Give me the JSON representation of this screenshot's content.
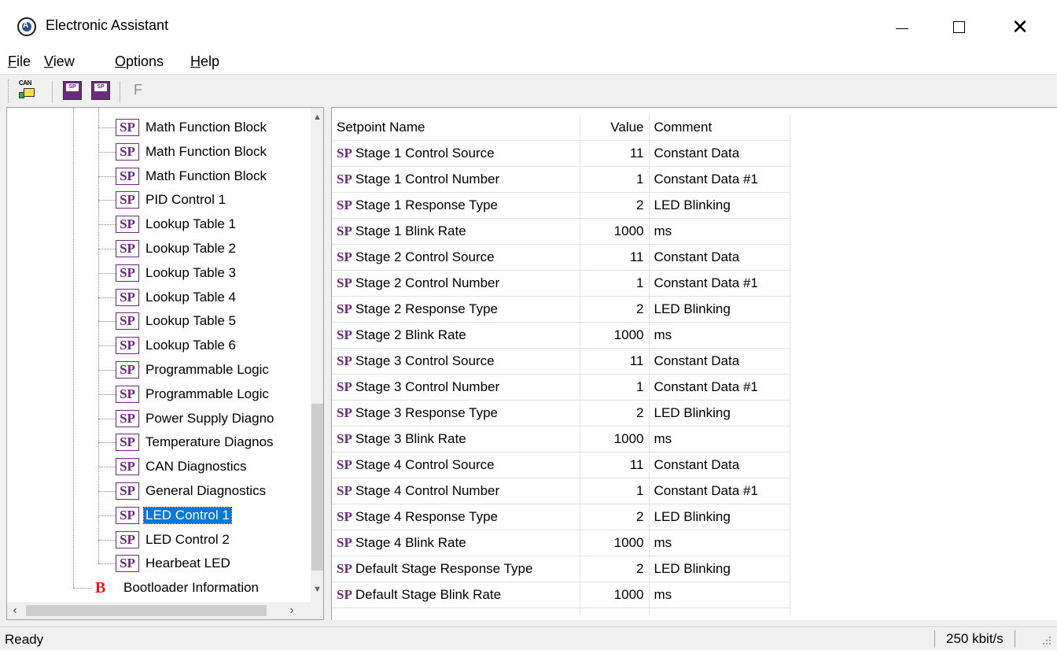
{
  "window": {
    "title": "Electronic Assistant",
    "minimize_icon": "minimize-icon",
    "maximize_icon": "maximize-icon",
    "close_label": "✕"
  },
  "menu": [
    {
      "first": "F",
      "rest": "ile"
    },
    {
      "first": "V",
      "rest": "iew"
    },
    {
      "first": "O",
      "rest": "ptions"
    },
    {
      "first": "H",
      "rest": "elp"
    }
  ],
  "toolbar": {
    "can_label": "CAN",
    "sp_label": "SP",
    "f_label": "F"
  },
  "tree": {
    "sp_badge": "SP",
    "b_badge": "B",
    "items": [
      "Math Function Block",
      "Math Function Block",
      "Math Function Block",
      "PID Control 1",
      "Lookup Table 1",
      "Lookup Table 2",
      "Lookup Table 3",
      "Lookup Table 4",
      "Lookup Table 5",
      "Lookup Table 6",
      "Programmable Logic",
      "Programmable Logic",
      "Power Supply Diagno",
      "Temperature Diagnos",
      "CAN Diagnostics",
      "General Diagnostics",
      "LED Control 1",
      "LED Control 2",
      "Hearbeat LED"
    ],
    "selected_index": 16,
    "bootloader": "Bootloader Information"
  },
  "grid": {
    "columns": [
      "Setpoint Name",
      "Value",
      "Comment"
    ],
    "sp_prefix": "SP",
    "rows": [
      {
        "name": "Stage 1 Control Source",
        "value": "11",
        "comment": "Constant Data"
      },
      {
        "name": "Stage 1 Control Number",
        "value": "1",
        "comment": "Constant Data #1"
      },
      {
        "name": "Stage 1 Response Type",
        "value": "2",
        "comment": "LED Blinking"
      },
      {
        "name": "Stage 1 Blink Rate",
        "value": "1000",
        "comment": "ms"
      },
      {
        "name": "Stage 2 Control Source",
        "value": "11",
        "comment": "Constant Data"
      },
      {
        "name": "Stage 2 Control Number",
        "value": "1",
        "comment": "Constant Data #1"
      },
      {
        "name": "Stage 2 Response Type",
        "value": "2",
        "comment": "LED Blinking"
      },
      {
        "name": "Stage 2 Blink Rate",
        "value": "1000",
        "comment": "ms"
      },
      {
        "name": "Stage 3 Control Source",
        "value": "11",
        "comment": "Constant Data"
      },
      {
        "name": "Stage 3 Control Number",
        "value": "1",
        "comment": "Constant Data #1"
      },
      {
        "name": "Stage 3 Response Type",
        "value": "2",
        "comment": "LED Blinking"
      },
      {
        "name": "Stage 3 Blink Rate",
        "value": "1000",
        "comment": "ms"
      },
      {
        "name": "Stage 4 Control Source",
        "value": "11",
        "comment": "Constant Data"
      },
      {
        "name": "Stage 4 Control Number",
        "value": "1",
        "comment": "Constant Data #1"
      },
      {
        "name": "Stage 4 Response Type",
        "value": "2",
        "comment": "LED Blinking"
      },
      {
        "name": "Stage 4 Blink Rate",
        "value": "1000",
        "comment": "ms"
      },
      {
        "name": "Default Stage Response Type",
        "value": "2",
        "comment": "LED Blinking"
      },
      {
        "name": "Default Stage Blink Rate",
        "value": "1000",
        "comment": "ms"
      }
    ]
  },
  "status": {
    "text": "Ready",
    "rate": "250 kbit/s"
  },
  "colors": {
    "sp_purple": "#6b2b7a",
    "selection_blue": "#0078d7",
    "bootloader_red": "#e01a1a"
  }
}
